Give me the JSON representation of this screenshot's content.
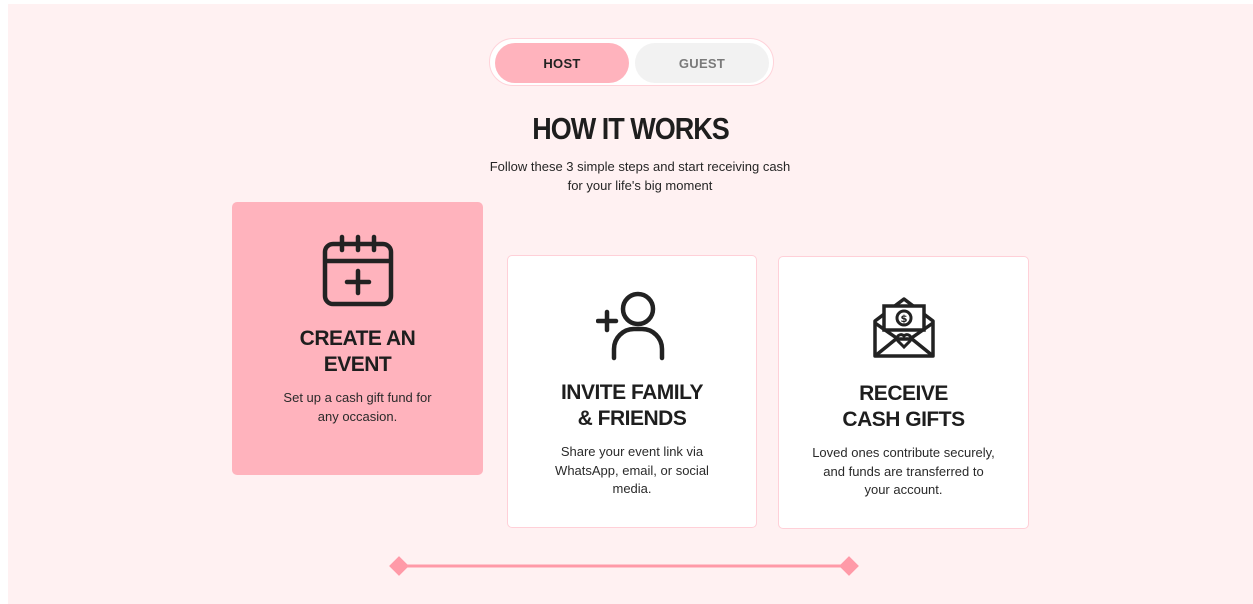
{
  "toggle": {
    "host_label": "HOST",
    "guest_label": "GUEST",
    "selected": "HOST"
  },
  "section": {
    "title": "HOW IT WORKS",
    "subtitle": "Follow these 3 simple steps and start receiving cash\nfor your life's big moment"
  },
  "steps": [
    {
      "title": "CREATE AN\nEVENT",
      "description": "Set up a cash gift fund for\nany occasion.",
      "icon": "calendar-plus-icon",
      "active": true
    },
    {
      "title": "INVITE FAMILY\n& FRIENDS",
      "description": "Share your event link via\nWhatsApp, email, or social\nmedia.",
      "icon": "add-user-icon",
      "active": false
    },
    {
      "title": "RECEIVE\nCASH GIFTS",
      "description": "Loved ones contribute securely,\nand funds are transferred to\nyour account.",
      "icon": "money-envelope-icon",
      "active": false
    }
  ],
  "colors": {
    "page_background": "#fff1f2",
    "accent_pink": "#ffb3bd",
    "slider_pink": "#ff9aa8",
    "text_dark": "#1e1e1e"
  }
}
